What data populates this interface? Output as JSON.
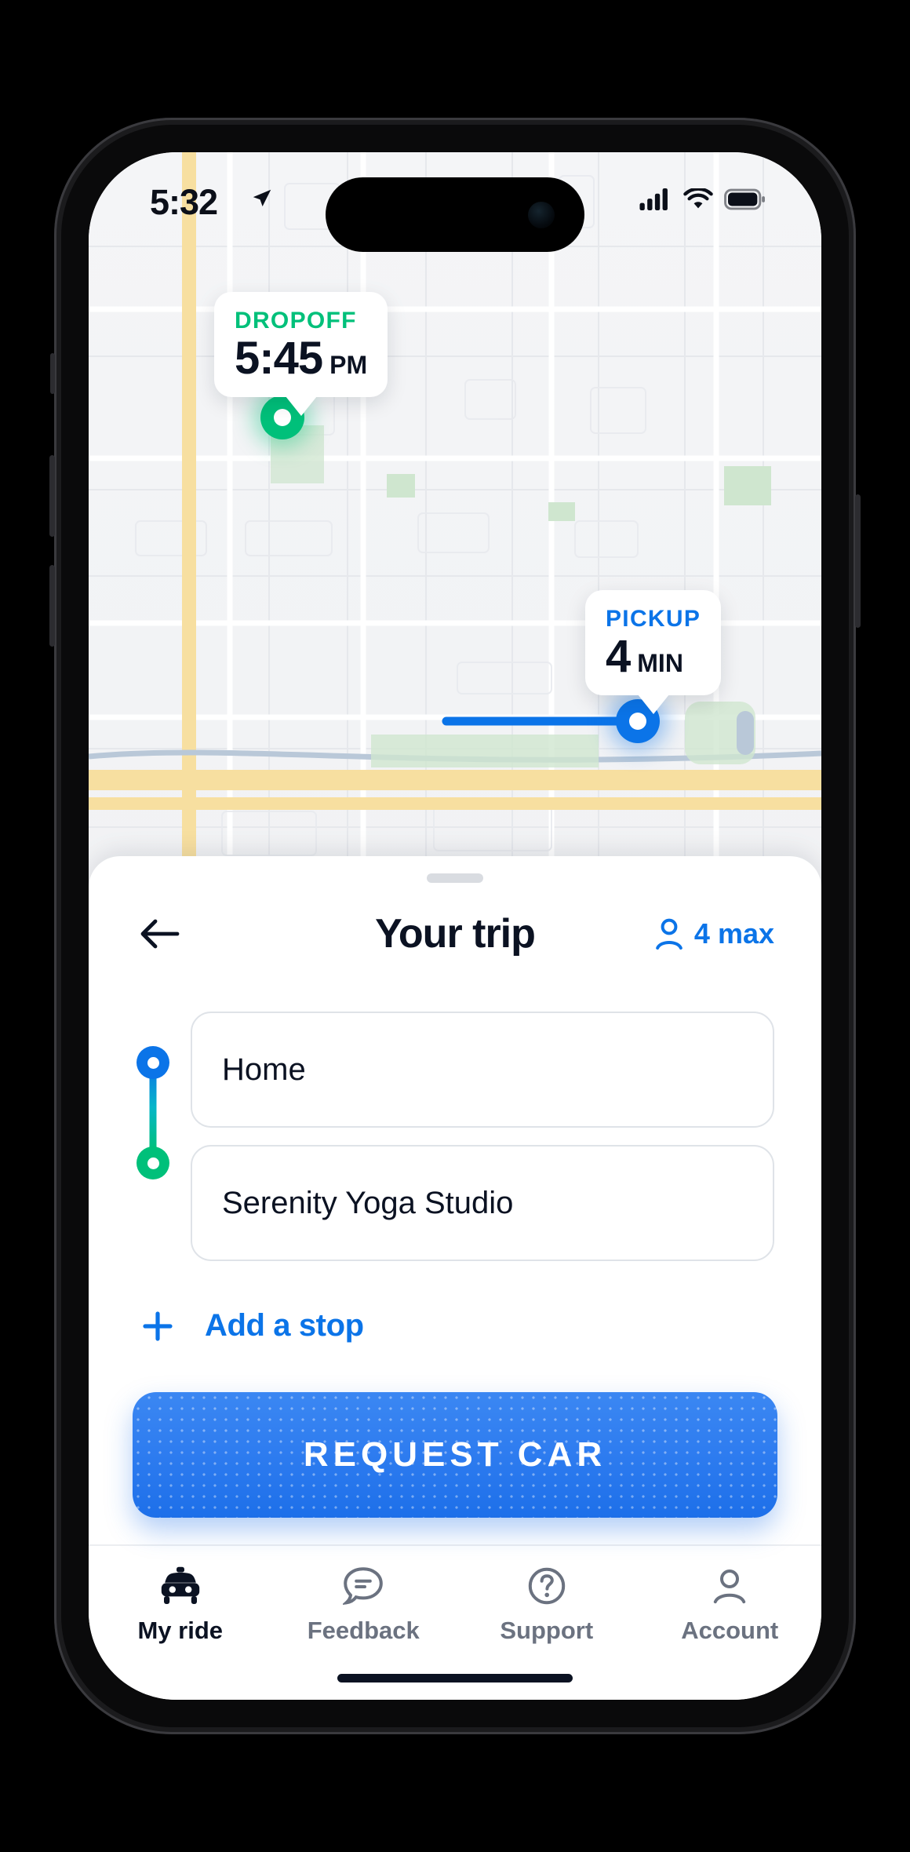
{
  "status_bar": {
    "time": "5:32",
    "location_icon": "location-arrow-icon",
    "signal_icon": "cellular-signal-icon",
    "wifi_icon": "wifi-icon",
    "battery_icon": "battery-full-icon"
  },
  "map": {
    "dropoff_callout": {
      "label": "DROPOFF",
      "value": "5:45",
      "unit": "PM",
      "color": "#00c07a"
    },
    "pickup_callout": {
      "label": "PICKUP",
      "value": "4",
      "unit": "MIN",
      "color": "#0b74e8"
    },
    "dropoff_marker": "dropoff-marker",
    "pickup_marker": "pickup-marker",
    "route_colors": {
      "dropoff_leg": "#00c07a",
      "pickup_leg": "#0b74e8"
    }
  },
  "sheet": {
    "grabber": "sheet-drag-handle",
    "back_icon": "back-arrow-icon",
    "title": "Your trip",
    "passenger": {
      "icon": "person-icon",
      "label": "4 max",
      "color": "#0b74e8"
    },
    "trip": {
      "origin": {
        "value": "Home",
        "placeholder": "Pickup location",
        "dot_color": "#0b74e8"
      },
      "destination": {
        "value": "Serenity Yoga Studio",
        "placeholder": "Destination",
        "dot_color": "#00c07a"
      }
    },
    "add_stop": {
      "icon": "plus-icon",
      "label": "Add a stop",
      "color": "#0b74e8"
    },
    "cta": {
      "label": "REQUEST CAR",
      "color": "#1d6fe9"
    }
  },
  "tabbar": {
    "items": [
      {
        "label": "My ride",
        "icon": "taxi-icon",
        "active": true
      },
      {
        "label": "Feedback",
        "icon": "speech-bubble-icon",
        "active": false
      },
      {
        "label": "Support",
        "icon": "question-circle-icon",
        "active": false
      },
      {
        "label": "Account",
        "icon": "person-icon",
        "active": false
      }
    ]
  }
}
